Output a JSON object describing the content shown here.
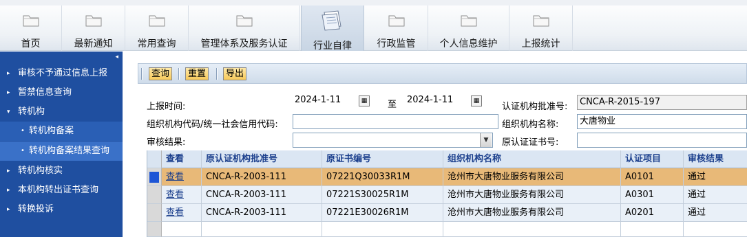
{
  "topnav": {
    "items": [
      {
        "label": "首页",
        "icon": "folder-icon"
      },
      {
        "label": "最新通知",
        "icon": "folder-icon"
      },
      {
        "label": "常用查询",
        "icon": "folder-icon"
      },
      {
        "label": "管理体系及服务认证",
        "icon": "folder-icon"
      },
      {
        "label": "行业自律",
        "icon": "document-stack-icon",
        "active": true
      },
      {
        "label": "行政监管",
        "icon": "folder-icon"
      },
      {
        "label": "个人信息维护",
        "icon": "folder-icon"
      },
      {
        "label": "上报统计",
        "icon": "folder-icon"
      }
    ]
  },
  "sidebar": {
    "collapse_glyph": "◂",
    "items": [
      {
        "label": "审核不予通过信息上报",
        "arrow": "▸"
      },
      {
        "label": "暂禁信息查询",
        "arrow": "▸"
      },
      {
        "label": "转机构",
        "arrow": "▾"
      },
      {
        "label": "转机构备案",
        "sub": true
      },
      {
        "label": "转机构备案结果查询",
        "sub": true,
        "selected": true
      },
      {
        "label": "转机构核实",
        "arrow": "▸"
      },
      {
        "label": "本机构转出证书查询",
        "arrow": "▸"
      },
      {
        "label": "转换投诉",
        "arrow": "▸"
      }
    ]
  },
  "toolbar": {
    "query_label": "查询",
    "reset_label": "重置",
    "export_label": "导出"
  },
  "form": {
    "report_time_label": "上报时间:",
    "date_from": "2024-1-11",
    "to_label": "至",
    "date_to": "2024-1-11",
    "approval_no_label": "认证机构批准号:",
    "approval_no_value": "CNCA-R-2015-197",
    "org_code_label": "组织机构代码/统一社会信用代码:",
    "org_code_value": "",
    "org_name_label": "组织机构名称:",
    "org_name_value": "大唐物业",
    "audit_result_label": "审核结果:",
    "audit_result_value": "",
    "orig_cert_no_label": "原认证证书号:",
    "orig_cert_no_value": ""
  },
  "grid": {
    "headers": [
      "查看",
      "原认证机构批准号",
      "原证书编号",
      "组织机构名称",
      "认证项目",
      "审核结果"
    ],
    "rows": [
      {
        "view": "查看",
        "approval_no": "CNCA-R-2003-111",
        "cert_no": "07221Q30033R1M",
        "org_name": "沧州市大唐物业服务有限公司",
        "item": "A0101",
        "result": "通过"
      },
      {
        "view": "查看",
        "approval_no": "CNCA-R-2003-111",
        "cert_no": "07221S30025R1M",
        "org_name": "沧州市大唐物业服务有限公司",
        "item": "A0301",
        "result": "通过"
      },
      {
        "view": "查看",
        "approval_no": "CNCA-R-2003-111",
        "cert_no": "07221E30026R1M",
        "org_name": "沧州市大唐物业服务有限公司",
        "item": "A0201",
        "result": "通过"
      }
    ]
  },
  "colors": {
    "sidebar_bg": "#1f4fa0",
    "selected_row": "#e8b978",
    "grid_header_text": "#1a3e8c",
    "button_bg": "#f7c95a"
  }
}
